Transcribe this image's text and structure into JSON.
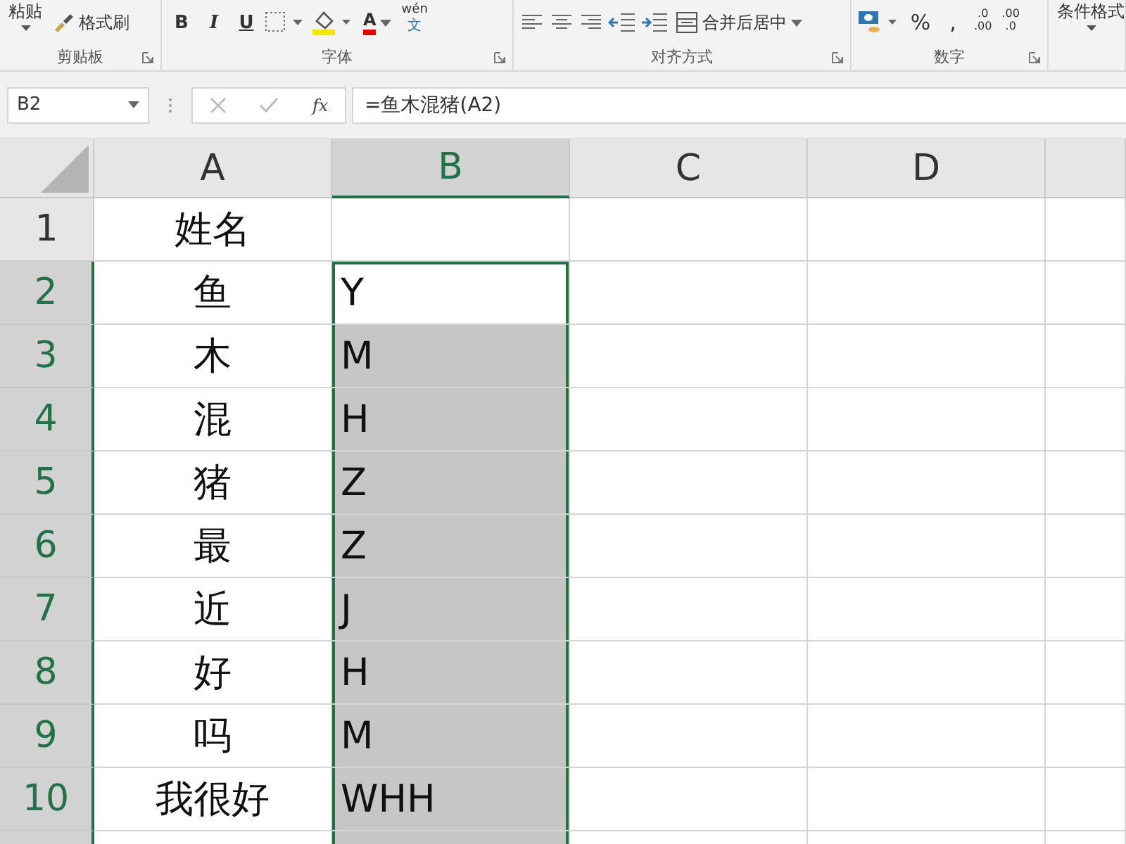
{
  "ribbon": {
    "groups": [
      {
        "label": "剪贴板",
        "items": [
          {
            "kind": "paste",
            "label": "粘贴"
          },
          {
            "kind": "brush",
            "label": "格式刷"
          }
        ]
      },
      {
        "label": "字体",
        "items": [
          {
            "kind": "bold",
            "label": "B"
          },
          {
            "kind": "italic",
            "label": "I"
          },
          {
            "kind": "underline",
            "label": "U"
          },
          {
            "kind": "borders"
          },
          {
            "kind": "fill"
          },
          {
            "kind": "fontcolor",
            "label": "A"
          },
          {
            "kind": "phonetic",
            "label": "wén",
            "sub": "文"
          }
        ]
      },
      {
        "label": "对齐方式",
        "items": [
          {
            "kind": "alignleft"
          },
          {
            "kind": "aligncenter"
          },
          {
            "kind": "alignright"
          },
          {
            "kind": "outdent"
          },
          {
            "kind": "indent"
          },
          {
            "kind": "merge",
            "label": "合并后居中"
          }
        ]
      },
      {
        "label": "数字",
        "items": [
          {
            "kind": "currency"
          },
          {
            "kind": "percent",
            "label": "%"
          },
          {
            "kind": "comma",
            "label": ","
          },
          {
            "kind": "decimal",
            "top": ".0",
            "bottom": ".00"
          },
          {
            "kind": "decimal",
            "top": ".00",
            "bottom": ".0"
          }
        ]
      },
      {
        "items": [
          {
            "kind": "cond",
            "label": "条件格式"
          }
        ]
      }
    ]
  },
  "formula_bar": {
    "name_box": "B2",
    "function_label": "fx",
    "formula": "=鱼木混猪(A2)"
  },
  "columns": [
    {
      "label": "A",
      "selected": false
    },
    {
      "label": "B",
      "selected": true
    },
    {
      "label": "C",
      "selected": false
    },
    {
      "label": "D",
      "selected": false
    }
  ],
  "rows": [
    {
      "number": "1",
      "a": "姓名",
      "selected": false,
      "active": false
    },
    {
      "number": "2",
      "a": "鱼",
      "b": "Y",
      "selected": true,
      "active": true
    },
    {
      "number": "3",
      "a": "木",
      "b": "M",
      "selected": true,
      "active": false
    },
    {
      "number": "4",
      "a": "混",
      "b": "H",
      "selected": true,
      "active": false
    },
    {
      "number": "5",
      "a": "猪",
      "b": "Z",
      "selected": true,
      "active": false
    },
    {
      "number": "6",
      "a": "最",
      "b": "Z",
      "selected": true,
      "active": false
    },
    {
      "number": "7",
      "a": "近",
      "b": "J",
      "selected": true,
      "active": false
    },
    {
      "number": "8",
      "a": "好",
      "b": "H",
      "selected": true,
      "active": false
    },
    {
      "number": "9",
      "a": "吗",
      "b": "M",
      "selected": true,
      "active": false
    },
    {
      "number": "10",
      "a": "我很好",
      "b": "WHH",
      "selected": true,
      "active": false
    },
    {
      "selected": true,
      "active": false
    }
  ]
}
